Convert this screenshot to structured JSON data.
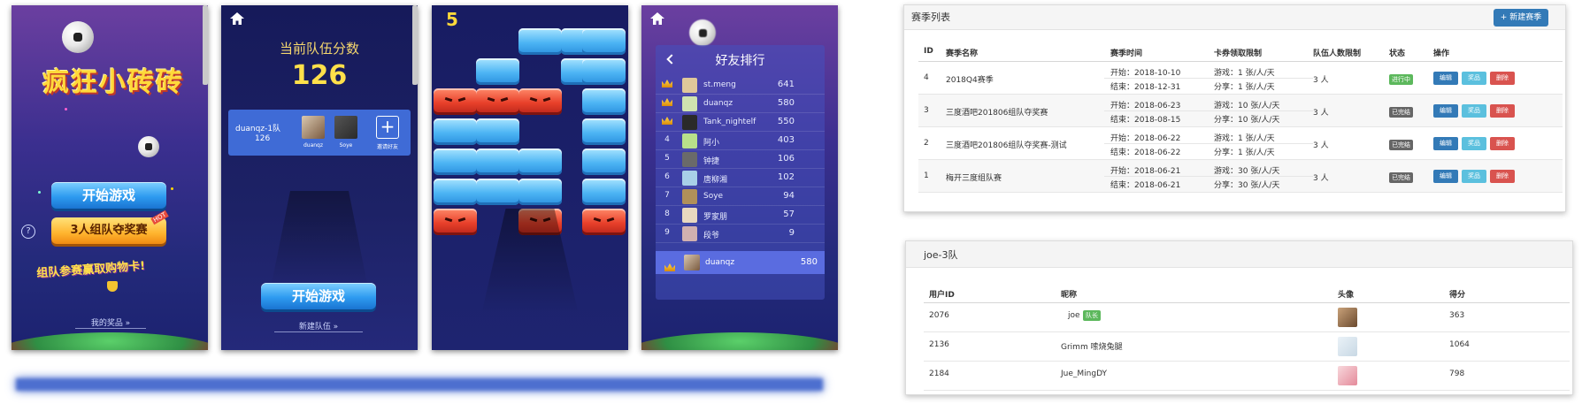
{
  "screen1": {
    "title": "疯狂小砖砖",
    "start_button": "开始游戏",
    "team_button": "3人组队夺奖赛",
    "hot_tag": "HOT",
    "promo_text": "组队参赛赢取购物卡!",
    "my_prizes": "我的奖品 »",
    "help_icon": "?"
  },
  "screen2": {
    "score_label": "当前队伍分数",
    "score_value": "126",
    "team_name": "duanqz-1队",
    "team_score": "126",
    "members": [
      {
        "name": "duanqz"
      },
      {
        "name": "Soye"
      }
    ],
    "invite_label": "邀请好友",
    "start_button": "开始游戏",
    "new_team": "新建队伍 »"
  },
  "screen3": {
    "level": "5",
    "rows": [
      [
        "",
        "",
        "blue",
        "blue",
        "blue"
      ],
      [
        "",
        "blue",
        "",
        "blue",
        "blue"
      ],
      [
        "red",
        "red",
        "red",
        "",
        "blue"
      ],
      [
        "blue",
        "blue",
        "",
        "",
        "blue"
      ],
      [
        "blue",
        "blue",
        "blue",
        "",
        "blue"
      ],
      [
        "blue",
        "blue",
        "blue",
        "",
        "blue"
      ],
      [
        "red",
        "",
        "red",
        "",
        "red"
      ]
    ]
  },
  "screen4": {
    "title": "好友排行",
    "rows": [
      {
        "rank": "crown",
        "name": "st.meng",
        "score": "641"
      },
      {
        "rank": "crown",
        "name": "duanqz",
        "score": "580"
      },
      {
        "rank": "crown",
        "name": "Tank_nightelf",
        "score": "550"
      },
      {
        "rank": "4",
        "name": "阿小",
        "score": "403"
      },
      {
        "rank": "5",
        "name": "钟捷",
        "score": "106"
      },
      {
        "rank": "6",
        "name": "唐柳湘",
        "score": "102"
      },
      {
        "rank": "7",
        "name": "Soye",
        "score": "94"
      },
      {
        "rank": "8",
        "name": "罗家朋",
        "score": "57"
      },
      {
        "rank": "9",
        "name": "段爷",
        "score": "9"
      }
    ],
    "self_row": {
      "rank": "crown",
      "name": "duanqz",
      "score": "580"
    }
  },
  "season_table": {
    "title": "赛季列表",
    "new_button": "+ 新建赛季",
    "columns": [
      "ID",
      "赛季名称",
      "赛季时间",
      "卡券领取限制",
      "队伍人数限制",
      "状态",
      "操作"
    ],
    "rows": [
      {
        "id": "4",
        "name": "2018Q4赛季",
        "start": "开始：2018-10-10",
        "end": "结束：2018-12-31",
        "limit_game": "游戏：1 张/人/天",
        "limit_share": "分享：1 张/人/天",
        "team": "3 人",
        "status": "进行中",
        "status_color": "#5cb85c"
      },
      {
        "id": "3",
        "name": "三度酒吧201806组队夺奖赛",
        "start": "开始：2018-06-23",
        "end": "结束：2018-08-15",
        "limit_game": "游戏：10 张/人/天",
        "limit_share": "分享：10 张/人/天",
        "team": "3 人",
        "status": "已完结",
        "status_color": "#666666"
      },
      {
        "id": "2",
        "name": "三度酒吧201806组队夺奖赛-测试",
        "start": "开始：2018-06-22",
        "end": "结束：2018-06-22",
        "limit_game": "游戏：1 张/人/天",
        "limit_share": "分享：1 张/人/天",
        "team": "3 人",
        "status": "已完结",
        "status_color": "#666666"
      },
      {
        "id": "1",
        "name": "梅开三度组队赛",
        "start": "开始：2018-06-21",
        "end": "结束：2018-06-21",
        "limit_game": "游戏：30 张/人/天",
        "limit_share": "分享：30 张/人/天",
        "team": "3 人",
        "status": "已完结",
        "status_color": "#666666"
      }
    ],
    "ops": {
      "edit": "编辑",
      "prize": "奖品",
      "delete": "删除"
    }
  },
  "team_table": {
    "title": "joe-3队",
    "columns": [
      "用户ID",
      "昵称",
      "头像",
      "得分"
    ],
    "leader_badge": "队长",
    "rows": [
      {
        "id": "2076",
        "nick": "joe",
        "score": "363"
      },
      {
        "id": "2136",
        "nick": "Grimm 嗦烧兔腿",
        "score": "1064"
      },
      {
        "id": "2184",
        "nick": "Jue_MingDY",
        "score": "798"
      }
    ]
  }
}
